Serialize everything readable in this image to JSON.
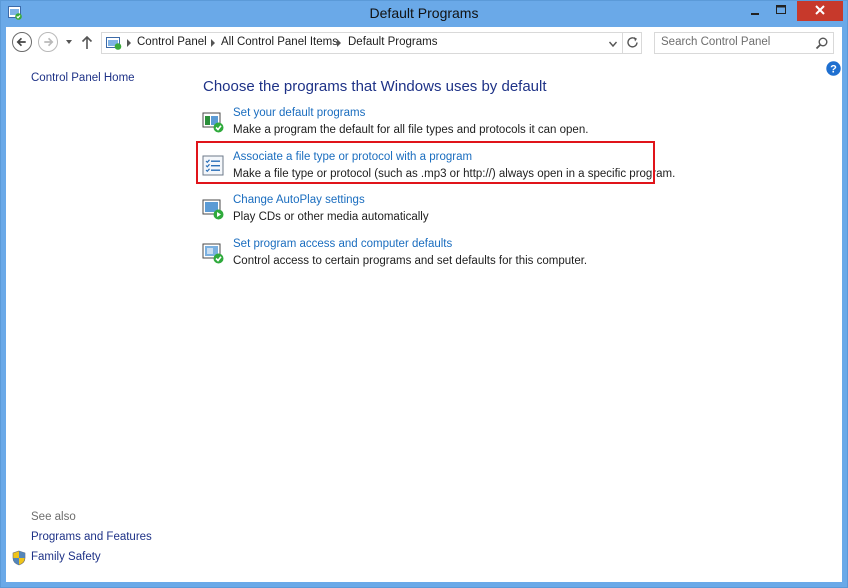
{
  "window": {
    "title": "Default Programs",
    "app_icon": "control-panel-default-programs-icon",
    "colors": {
      "frame": "#6aa9e8",
      "close": "#c7392b",
      "highlight": "#e0141a",
      "link": "#1a6dbf",
      "heading": "#1e3287"
    }
  },
  "nav": {
    "breadcrumbs": [
      "Control Panel",
      "All Control Panel Items",
      "Default Programs"
    ],
    "search_placeholder": "Search Control Panel"
  },
  "left_pane": {
    "home_link": "Control Panel Home",
    "see_also_label": "See also",
    "see_also_links": [
      "Programs and Features",
      "Family Safety"
    ]
  },
  "main": {
    "heading": "Choose the programs that Windows uses by default",
    "tasks": [
      {
        "icon": "default-programs-check-icon",
        "title": "Set your default programs",
        "description": "Make a program the default for all file types and protocols it can open."
      },
      {
        "icon": "file-association-list-icon",
        "title": "Associate a file type or protocol with a program",
        "description": "Make a file type or protocol (such as .mp3 or http://) always open in a specific program."
      },
      {
        "icon": "autoplay-icon",
        "title": "Change AutoPlay settings",
        "description": "Play CDs or other media automatically"
      },
      {
        "icon": "program-access-check-icon",
        "title": "Set program access and computer defaults",
        "description": "Control access to certain programs and set defaults for this computer."
      }
    ]
  }
}
